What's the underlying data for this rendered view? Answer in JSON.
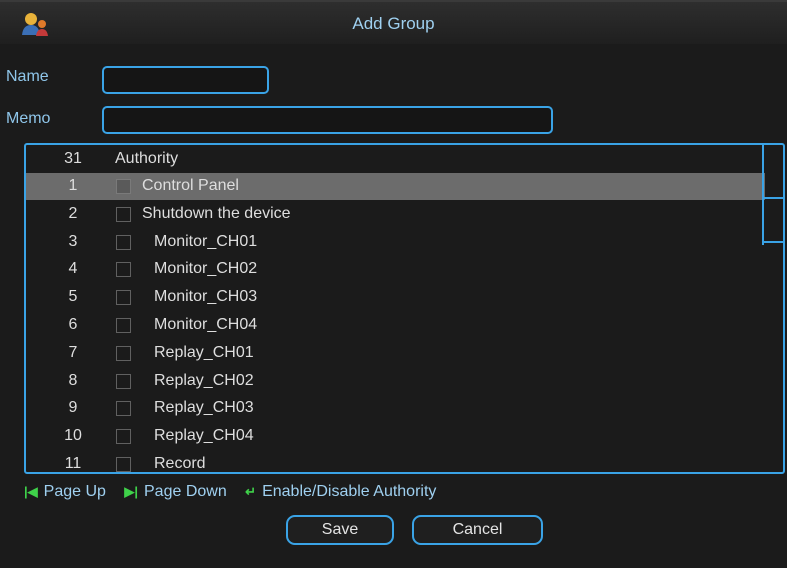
{
  "dialog": {
    "title": "Add Group",
    "icon": "user-group-icon"
  },
  "form": {
    "name_label": "Name",
    "name_value": "",
    "memo_label": "Memo",
    "memo_value": ""
  },
  "authority_list": {
    "count": "31",
    "header": "Authority",
    "rows": [
      {
        "num": "1",
        "label": "Control Panel",
        "checked": true,
        "selected": true
      },
      {
        "num": "2",
        "label": "Shutdown the device",
        "checked": false,
        "selected": false
      },
      {
        "num": "3",
        "label": "Monitor_CH01",
        "checked": false,
        "selected": false
      },
      {
        "num": "4",
        "label": "Monitor_CH02",
        "checked": false,
        "selected": false
      },
      {
        "num": "5",
        "label": "Monitor_CH03",
        "checked": false,
        "selected": false
      },
      {
        "num": "6",
        "label": "Monitor_CH04",
        "checked": false,
        "selected": false
      },
      {
        "num": "7",
        "label": "Replay_CH01",
        "checked": false,
        "selected": false
      },
      {
        "num": "8",
        "label": "Replay_CH02",
        "checked": false,
        "selected": false
      },
      {
        "num": "9",
        "label": "Replay_CH03",
        "checked": false,
        "selected": false
      },
      {
        "num": "10",
        "label": "Replay_CH04",
        "checked": false,
        "selected": false
      },
      {
        "num": "11",
        "label": "Record",
        "checked": false,
        "selected": false
      }
    ]
  },
  "hints": {
    "page_up_icon": "page-up-icon",
    "page_up": "Page Up",
    "page_down_icon": "page-down-icon",
    "page_down": "Page Down",
    "toggle_icon": "enter-icon",
    "toggle": "Enable/Disable Authority"
  },
  "buttons": {
    "save": "Save",
    "cancel": "Cancel"
  },
  "colors": {
    "accent": "#3aa3e6",
    "title_text": "#9fd0f0",
    "hint_icon": "#3fd24a",
    "selected_row": "#6c6c6c"
  }
}
